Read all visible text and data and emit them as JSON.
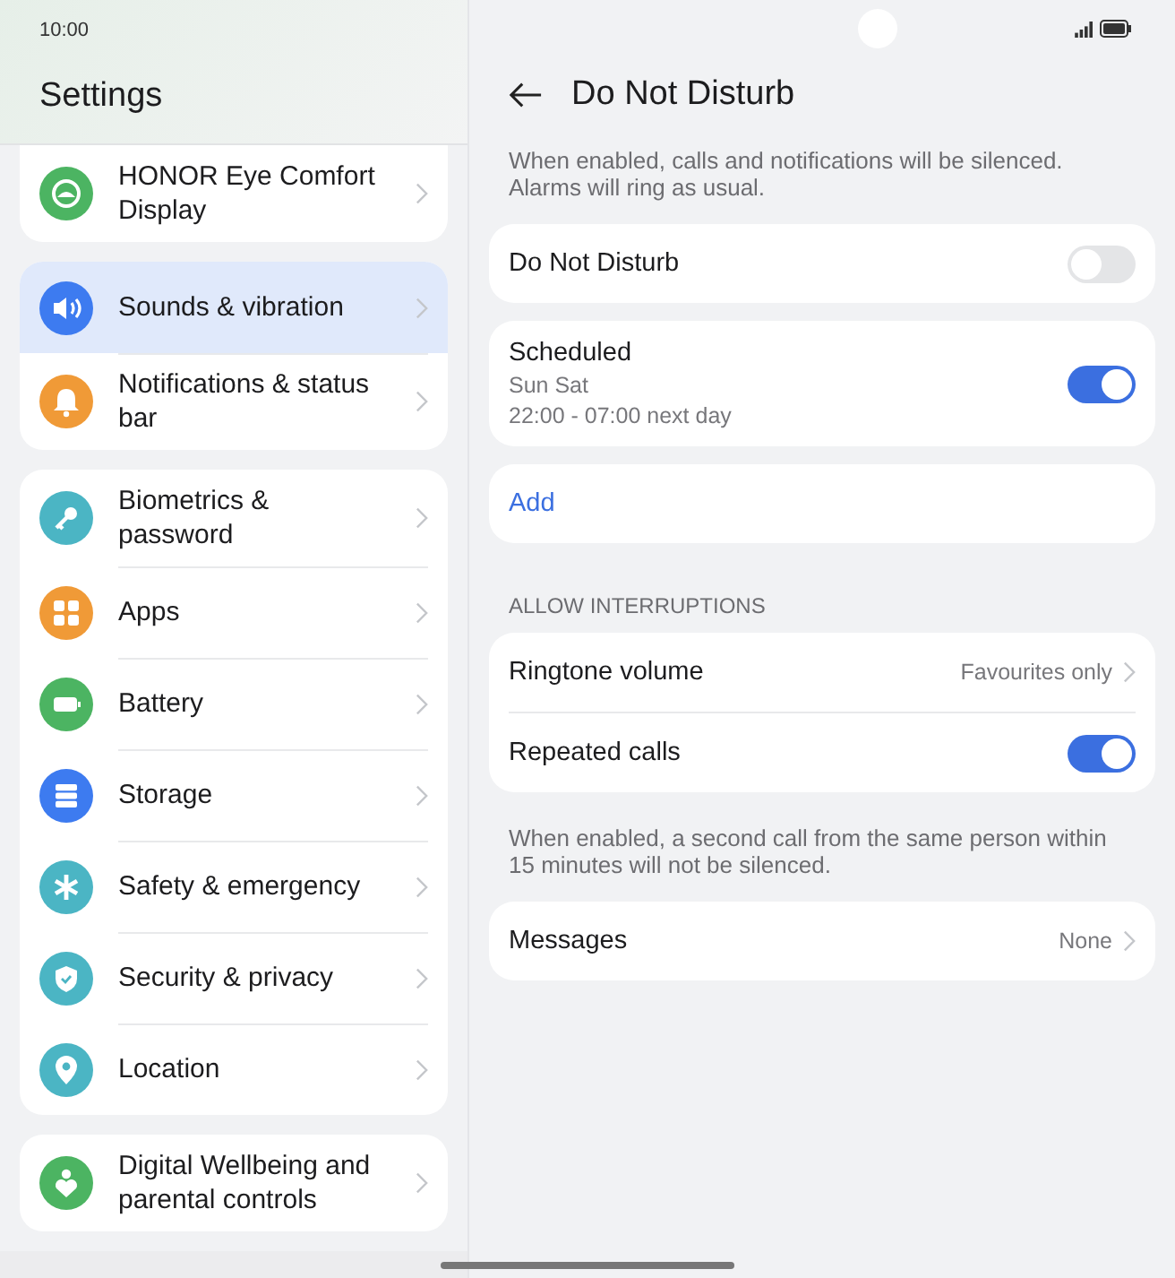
{
  "status_bar": {
    "time": "10:00"
  },
  "sidebar": {
    "title": "Settings",
    "groups": [
      {
        "items": [
          {
            "label": "HONOR Eye Comfort Display",
            "color": "#4cb462",
            "selected": false
          }
        ]
      },
      {
        "items": [
          {
            "label": "Sounds & vibration",
            "color": "#3d7bf0",
            "selected": true
          },
          {
            "label": "Notifications & status bar",
            "color": "#f09a37",
            "selected": false
          }
        ]
      },
      {
        "items": [
          {
            "label": "Biometrics & password",
            "color": "#4bb5c4",
            "selected": false
          },
          {
            "label": "Apps",
            "color": "#f09a37",
            "selected": false
          },
          {
            "label": "Battery",
            "color": "#4cb462",
            "selected": false
          },
          {
            "label": "Storage",
            "color": "#3d7bf0",
            "selected": false
          },
          {
            "label": "Safety & emergency",
            "color": "#4bb5c4",
            "selected": false
          },
          {
            "label": "Security & privacy",
            "color": "#4bb5c4",
            "selected": false
          },
          {
            "label": "Location",
            "color": "#4bb5c4",
            "selected": false
          }
        ]
      },
      {
        "items": [
          {
            "label": "Digital Wellbeing and parental controls",
            "color": "#4cb462",
            "selected": false
          }
        ]
      }
    ]
  },
  "detail": {
    "title": "Do Not Disturb",
    "sections": [
      {
        "kind": "note",
        "text": "When enabled, calls and notifications will be silenced. Alarms will ring as usual."
      },
      {
        "kind": "card",
        "rows": [
          {
            "kind": "toggle",
            "label": "Do Not Disturb",
            "on": false
          }
        ]
      },
      {
        "kind": "card",
        "rows": [
          {
            "kind": "toggle",
            "label": "Scheduled",
            "sublines": [
              "Sun Sat",
              "22:00 - 07:00 next day"
            ],
            "on": true
          }
        ]
      },
      {
        "kind": "card",
        "rows": [
          {
            "kind": "action",
            "label": "Add"
          }
        ]
      },
      {
        "kind": "header",
        "text": "ALLOW INTERRUPTIONS"
      },
      {
        "kind": "card",
        "rows": [
          {
            "kind": "value",
            "label": "Ringtone volume",
            "value": "Favourites only"
          },
          {
            "kind": "toggle",
            "label": "Repeated calls",
            "on": true
          }
        ]
      },
      {
        "kind": "note",
        "text": "When enabled, a second call from the same person within 15 minutes will not be silenced."
      },
      {
        "kind": "card",
        "rows": [
          {
            "kind": "value",
            "label": "Messages",
            "value": "None"
          }
        ]
      }
    ]
  }
}
